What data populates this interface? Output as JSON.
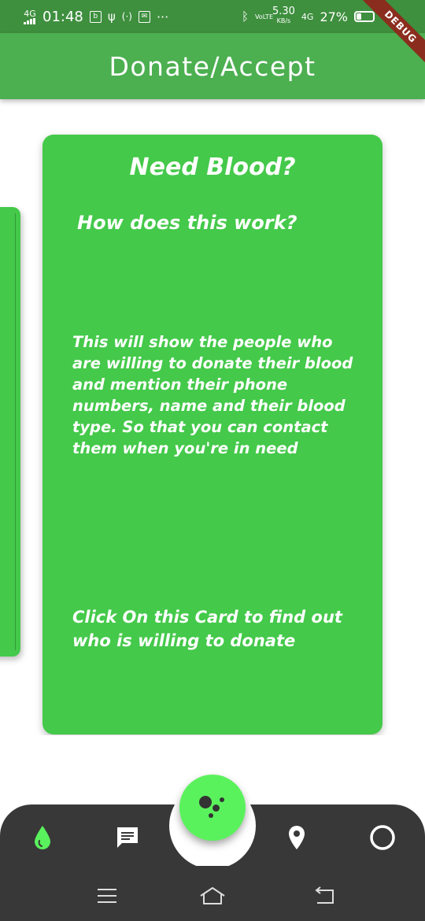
{
  "status_bar": {
    "network": "4G",
    "time": "01:48",
    "speed_value": "5.30",
    "speed_unit": "KB/s",
    "volte": "VoLTE",
    "network_right": "4G",
    "battery": "27%",
    "icons": [
      "signal-icon",
      "notification-icon",
      "usb-icon",
      "hotspot-icon",
      "mail-icon",
      "more-icon",
      "bluetooth-icon",
      "battery-icon"
    ]
  },
  "debug_banner": "DEBUG",
  "app_bar": {
    "title": "Donate/Accept"
  },
  "card": {
    "title": "Need Blood?",
    "subtitle": "How does this work?",
    "description": "This will show the people who are willing to donate their blood and mention their phone numbers, name and their blood type. So that you can contact them when you're in need",
    "cta": "Click On this Card to find out who is willing to donate"
  },
  "bottom_nav": {
    "items": [
      "blood-drop-icon",
      "chat-icon",
      "location-pin-icon",
      "circle-icon"
    ],
    "fab_icon": "assistant-dots-icon",
    "active_color": "#5af25c"
  },
  "colors": {
    "status_bar": "#3e8f3e",
    "app_bar": "#4caf50",
    "card": "#44c94a",
    "nav": "#383838"
  }
}
